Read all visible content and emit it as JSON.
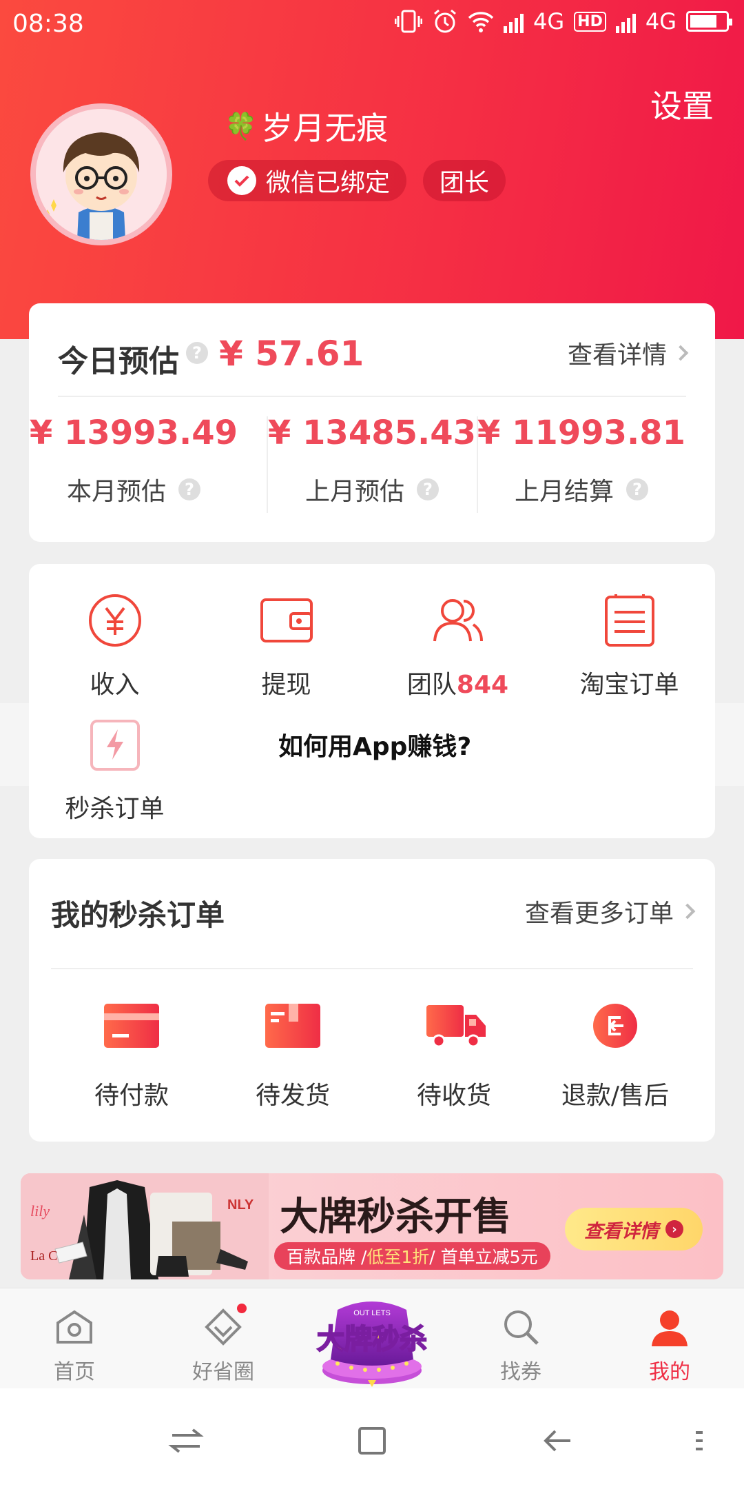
{
  "status_bar": {
    "time": "08:38",
    "net1": "4G",
    "hd": "HD",
    "net2": "4G"
  },
  "header": {
    "settings_label": "设置",
    "nickname": "岁月无痕",
    "clover": "🍀",
    "wechat_badge": "微信已绑定",
    "role_badge": "团长"
  },
  "earnings": {
    "today_label": "今日预估",
    "help_mark": "?",
    "today_value": "¥ 57.61",
    "detail_link": "查看详情",
    "stats": [
      {
        "value": "¥ 13993.49",
        "label": "本月预估"
      },
      {
        "value": "¥ 13485.43",
        "label": "上月预估"
      },
      {
        "value": "¥ 11993.81",
        "label": "上月结算"
      }
    ]
  },
  "tools": {
    "items": [
      {
        "label": "收入",
        "icon": "yen-circle-icon"
      },
      {
        "label": "提现",
        "icon": "wallet-icon"
      },
      {
        "label": "团队",
        "count": "844",
        "icon": "team-icon"
      },
      {
        "label": "淘宝订单",
        "icon": "order-list-icon"
      },
      {
        "label": "秒杀订单",
        "icon": "flash-order-icon"
      }
    ],
    "promo_text": "如何用App赚钱?"
  },
  "flash_orders": {
    "title": "我的秒杀订单",
    "more_link": "查看更多订单",
    "items": [
      {
        "label": "待付款",
        "icon": "card-icon"
      },
      {
        "label": "待发货",
        "icon": "package-icon"
      },
      {
        "label": "待收货",
        "icon": "truck-icon"
      },
      {
        "label": "退款/售后",
        "icon": "refund-icon"
      }
    ]
  },
  "banner": {
    "title": "大牌秒杀开售",
    "sub_prefix": "百款品牌 / ",
    "sub_highlight": "低至1折",
    "sub_suffix": " / 首单立减5元",
    "button": "查看详情",
    "brand_left": "La C",
    "brand_right": "NLY"
  },
  "tabbar": {
    "tabs": [
      {
        "label": "首页",
        "icon": "home-icon"
      },
      {
        "label": "好省圈",
        "icon": "circle-icon"
      },
      {
        "label": "大牌秒杀",
        "icon": "flash-sale-icon"
      },
      {
        "label": "找券",
        "icon": "search-icon"
      },
      {
        "label": "我的",
        "icon": "user-icon"
      }
    ],
    "center_top": "OUT LETS"
  },
  "colors": {
    "primary": "#f52e44",
    "accent_text": "#ef4a5a"
  }
}
